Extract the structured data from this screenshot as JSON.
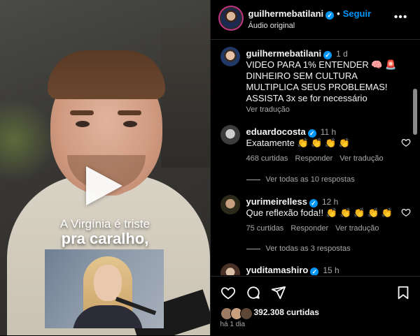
{
  "video": {
    "caption_line1": "A Virgínia é triste",
    "caption_line2": "pra caralho,"
  },
  "header": {
    "username": "guilhermebatilani",
    "follow_label": "Seguir",
    "subtitle": "Áudio original"
  },
  "caption": {
    "username": "guilhermebatilani",
    "time": "1 d",
    "text": "VIDEO PARA 1% ENTENDER 🧠 🚨 DINHEIRO SEM CULTURA MULTIPLICA SEUS PROBLEMAS! ASSISTA 3x se for necessário",
    "translate": "Ver tradução"
  },
  "comments": [
    {
      "username": "eduardocosta",
      "time": "11 h",
      "text": "Exatamente 👏 👏 👏 👏",
      "likes": "468 curtidas",
      "reply": "Responder",
      "translate": "Ver tradução",
      "replies": "Ver todas as 10 respostas"
    },
    {
      "username": "yurimeirelless",
      "time": "12 h",
      "text": "Que reflexão foda!! 👏 👏 👏 👏 👏",
      "likes": "75 curtidas",
      "reply": "Responder",
      "translate": "Ver tradução",
      "replies": "Ver todas as 3 respostas"
    },
    {
      "username": "yuditamashiro",
      "time": "15 h"
    }
  ],
  "footer": {
    "likes": "392.308 curtidas",
    "time": "há 1 dia"
  },
  "icons": {
    "accent": "#0095f6",
    "verified": "verified-badge-icon",
    "like": "heart-icon",
    "comment": "comment-icon",
    "share": "share-icon",
    "save": "bookmark-icon",
    "more": "more-icon",
    "play": "play-icon"
  }
}
